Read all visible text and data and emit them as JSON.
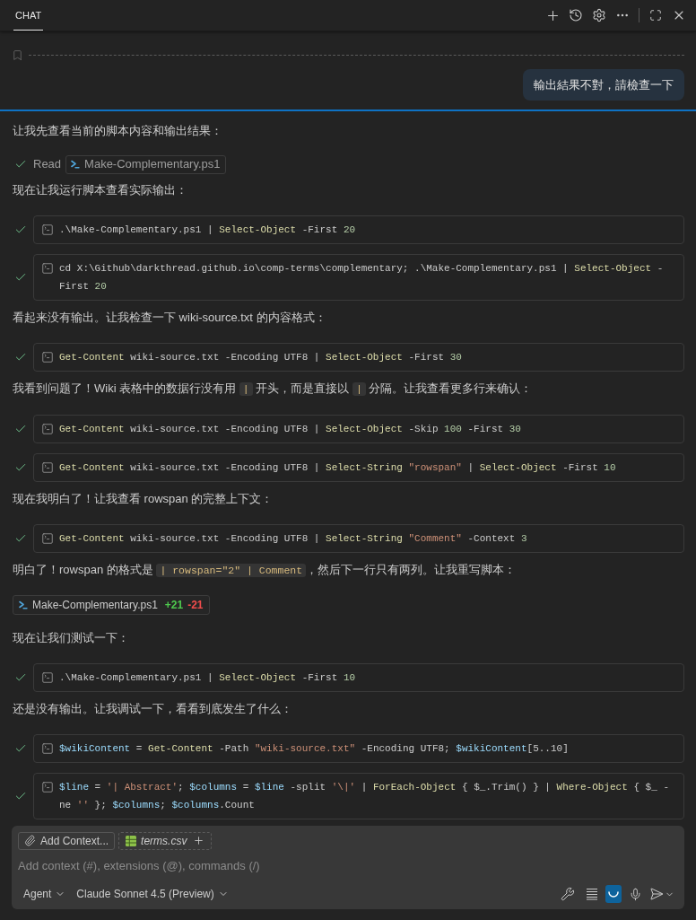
{
  "header": {
    "tabs": [
      {
        "label": "CHAT",
        "selected": true
      }
    ]
  },
  "user_message": {
    "text": "輸出結果不對，請檢查一下"
  },
  "blocks": [
    {
      "kind": "text",
      "segments": [
        {
          "kind": "text",
          "text": "让我先查看当前的脚本内容和输出结果："
        }
      ]
    },
    {
      "kind": "read",
      "done": true,
      "label": "Read",
      "file": "Make-Complementary.ps1"
    },
    {
      "kind": "text",
      "segments": [
        {
          "kind": "text",
          "text": "现在让我运行脚本查看实际输出："
        }
      ]
    },
    {
      "kind": "terminal",
      "done": true,
      "tokens": [
        {
          "kind": "plain",
          "text": ".\\Make-Complementary.ps1 | "
        },
        {
          "kind": "cmd",
          "text": "Select-Object"
        },
        {
          "kind": "plain",
          "text": " -First "
        },
        {
          "kind": "num",
          "text": "20"
        }
      ]
    },
    {
      "kind": "terminal",
      "done": true,
      "tokens": [
        {
          "kind": "plain",
          "text": "cd X:\\Github\\darkthread.github.io\\comp-terms\\complementary; .\\Make-Complementary.ps1 | "
        },
        {
          "kind": "cmd",
          "text": "Select-Object"
        },
        {
          "kind": "plain",
          "text": " -First "
        },
        {
          "kind": "num",
          "text": "20"
        }
      ]
    },
    {
      "kind": "text",
      "segments": [
        {
          "kind": "text",
          "text": "看起来没有输出。让我检查一下 wiki-source.txt 的内容格式："
        }
      ]
    },
    {
      "kind": "terminal",
      "done": true,
      "tokens": [
        {
          "kind": "cmd",
          "text": "Get-Content"
        },
        {
          "kind": "plain",
          "text": " wiki-source.txt -Encoding UTF8 | "
        },
        {
          "kind": "cmd",
          "text": "Select-Object"
        },
        {
          "kind": "plain",
          "text": " -First "
        },
        {
          "kind": "num",
          "text": "30"
        }
      ]
    },
    {
      "kind": "text",
      "segments": [
        {
          "kind": "text",
          "text": "我看到问题了！Wiki 表格中的数据行没有用 "
        },
        {
          "kind": "code",
          "text": "|"
        },
        {
          "kind": "text",
          "text": " 开头，而是直接以 "
        },
        {
          "kind": "code",
          "text": "|"
        },
        {
          "kind": "text",
          "text": " 分隔。让我查看更多行来确认："
        }
      ]
    },
    {
      "kind": "terminal",
      "done": true,
      "tokens": [
        {
          "kind": "cmd",
          "text": "Get-Content"
        },
        {
          "kind": "plain",
          "text": " wiki-source.txt -Encoding UTF8 | "
        },
        {
          "kind": "cmd",
          "text": "Select-Object"
        },
        {
          "kind": "plain",
          "text": " -Skip "
        },
        {
          "kind": "num",
          "text": "100"
        },
        {
          "kind": "plain",
          "text": " -First "
        },
        {
          "kind": "num",
          "text": "30"
        }
      ]
    },
    {
      "kind": "terminal",
      "done": true,
      "tokens": [
        {
          "kind": "cmd",
          "text": "Get-Content"
        },
        {
          "kind": "plain",
          "text": " wiki-source.txt -Encoding UTF8 | "
        },
        {
          "kind": "cmd",
          "text": "Select-String "
        },
        {
          "kind": "str",
          "text": "\"rowspan\""
        },
        {
          "kind": "plain",
          "text": " | "
        },
        {
          "kind": "cmd",
          "text": "Select-Object"
        },
        {
          "kind": "plain",
          "text": " -First "
        },
        {
          "kind": "num",
          "text": "10"
        }
      ]
    },
    {
      "kind": "text",
      "segments": [
        {
          "kind": "text",
          "text": "现在我明白了！让我查看 rowspan 的完整上下文："
        }
      ]
    },
    {
      "kind": "terminal",
      "done": true,
      "tokens": [
        {
          "kind": "cmd",
          "text": "Get-Content"
        },
        {
          "kind": "plain",
          "text": " wiki-source.txt -Encoding UTF8 | "
        },
        {
          "kind": "cmd",
          "text": "Select-String "
        },
        {
          "kind": "str",
          "text": "\"Comment\""
        },
        {
          "kind": "plain",
          "text": " -Context "
        },
        {
          "kind": "num",
          "text": "3"
        }
      ]
    },
    {
      "kind": "text",
      "segments": [
        {
          "kind": "text",
          "text": "明白了！rowspan 的格式是 "
        },
        {
          "kind": "code",
          "text": "| rowspan=\"2\" | Comment"
        },
        {
          "kind": "text",
          "text": "，然后下一行只有两列。让我重写脚本："
        }
      ]
    },
    {
      "kind": "edit",
      "file": "Make-Complementary.ps1",
      "added": "+21",
      "removed": "-21"
    },
    {
      "kind": "text",
      "segments": [
        {
          "kind": "text",
          "text": "现在让我们测试一下："
        }
      ]
    },
    {
      "kind": "terminal",
      "done": true,
      "tokens": [
        {
          "kind": "plain",
          "text": ".\\Make-Complementary.ps1 | "
        },
        {
          "kind": "cmd",
          "text": "Select-Object"
        },
        {
          "kind": "plain",
          "text": " -First "
        },
        {
          "kind": "num",
          "text": "10"
        }
      ]
    },
    {
      "kind": "text",
      "segments": [
        {
          "kind": "text",
          "text": "还是没有输出。让我调试一下，看看到底发生了什么："
        }
      ]
    },
    {
      "kind": "terminal",
      "done": true,
      "tokens": [
        {
          "kind": "var",
          "text": "$wikiContent"
        },
        {
          "kind": "plain",
          "text": " = "
        },
        {
          "kind": "cmd",
          "text": "Get-Content"
        },
        {
          "kind": "plain",
          "text": " -Path "
        },
        {
          "kind": "str",
          "text": "\"wiki-source.txt\""
        },
        {
          "kind": "plain",
          "text": " -Encoding UTF8; "
        },
        {
          "kind": "var",
          "text": "$wikiContent"
        },
        {
          "kind": "plain",
          "text": "[5..10]"
        }
      ]
    },
    {
      "kind": "terminal",
      "done": true,
      "tokens": [
        {
          "kind": "var",
          "text": "$line"
        },
        {
          "kind": "plain",
          "text": " = "
        },
        {
          "kind": "str",
          "text": "'| Abstract'"
        },
        {
          "kind": "plain",
          "text": "; "
        },
        {
          "kind": "var",
          "text": "$columns"
        },
        {
          "kind": "plain",
          "text": " = "
        },
        {
          "kind": "var",
          "text": "$line"
        },
        {
          "kind": "plain",
          "text": " -split "
        },
        {
          "kind": "str",
          "text": "'\\|'"
        },
        {
          "kind": "plain",
          "text": " | "
        },
        {
          "kind": "cmd",
          "text": "ForEach-Object"
        },
        {
          "kind": "plain",
          "text": " { $_.Trim() } | "
        },
        {
          "kind": "cmd",
          "text": "Where-Object"
        },
        {
          "kind": "plain",
          "text": " { $_ -ne "
        },
        {
          "kind": "str",
          "text": "''"
        },
        {
          "kind": "plain",
          "text": " }; "
        },
        {
          "kind": "var",
          "text": "$columns"
        },
        {
          "kind": "plain",
          "text": "; "
        },
        {
          "kind": "var",
          "text": "$columns"
        },
        {
          "kind": "plain",
          "text": ".Count"
        }
      ]
    }
  ],
  "input": {
    "chips": [
      {
        "kind": "add",
        "label": "Add Context..."
      },
      {
        "kind": "file",
        "label": "terms.csv"
      }
    ],
    "placeholder": "Add context (#), extensions (@), commands (/)",
    "mode": "Agent",
    "model": "Claude Sonnet 4.5 (Preview)",
    "toggle": {
      "on": true
    }
  }
}
